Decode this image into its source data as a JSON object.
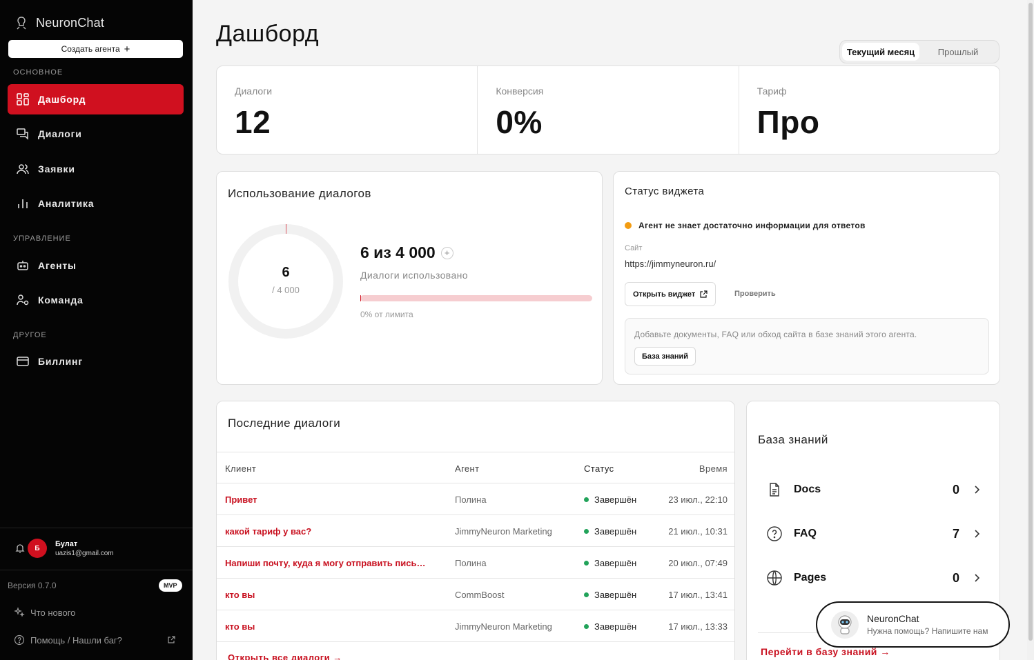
{
  "brand": {
    "name": "NeuronChat"
  },
  "sidebar": {
    "create_label": "Создать агента",
    "sections": {
      "main": "ОСНОВНОЕ",
      "manage": "УПРАВЛЕНИЕ",
      "other": "ДРУГОЕ"
    },
    "items": {
      "dashboard": "Дашборд",
      "dialogs": "Диалоги",
      "requests": "Заявки",
      "analytics": "Аналитика",
      "agents": "Агенты",
      "team": "Команда",
      "billing": "Биллинг"
    },
    "user": {
      "initial": "Б",
      "name": "Булат",
      "email": "uazis1@gmail.com"
    },
    "version": "Версия 0.7.0",
    "badge": "MVP",
    "whats_new": "Что нового",
    "help": "Помощь / Нашли баг?"
  },
  "page": {
    "title": "Дашборд"
  },
  "period": {
    "current": "Текущий месяц",
    "previous": "Прошлый"
  },
  "stats": [
    {
      "label": "Диалоги",
      "value": "12"
    },
    {
      "label": "Конверсия",
      "value": "0%"
    },
    {
      "label": "Тариф",
      "value": "Про"
    }
  ],
  "usage": {
    "title": "Использование диалогов",
    "ring_value": "6",
    "ring_total": "/ 4 000",
    "big": "6 из 4 000",
    "sub": "Диалоги использовано",
    "fraction": 0.0015,
    "pct_label": "0% от лимита"
  },
  "widget": {
    "title": "Статус виджета",
    "status": "Агент не знает достаточно информации для ответов",
    "status_color": "#f39c12",
    "site_label": "Сайт",
    "site_url": "https://jimmyneuron.ru/",
    "open_label": "Открыть виджет",
    "check_label": "Проверить",
    "hint": "Добавьте документы, FAQ или обход сайта в базе знаний этого агента.",
    "kb_button": "База знаний"
  },
  "recent": {
    "title": "Последние диалоги",
    "columns": {
      "client": "Клиент",
      "agent": "Агент",
      "status": "Статус",
      "time": "Время"
    },
    "rows": [
      {
        "client": "Привет",
        "agent": "Полина",
        "status": "Завершён",
        "time": "23 июл., 22:10"
      },
      {
        "client": "какой тариф у вас?",
        "agent": "JimmyNeuron Marketing",
        "status": "Завершён",
        "time": "21 июл., 10:31"
      },
      {
        "client": "Напиши почту, куда я могу отправить пись…",
        "agent": "Полина",
        "status": "Завершён",
        "time": "20 июл., 07:49"
      },
      {
        "client": "кто вы",
        "agent": "CommBoost",
        "status": "Завершён",
        "time": "17 июл., 13:41"
      },
      {
        "client": "кто вы",
        "agent": "JimmyNeuron Marketing",
        "status": "Завершён",
        "time": "17 июл., 13:33"
      }
    ],
    "all_link": "Открыть все диалоги →"
  },
  "kb": {
    "title": "База знаний",
    "items": [
      {
        "name": "Docs",
        "count": "0",
        "icon": "document-icon"
      },
      {
        "name": "FAQ",
        "count": "7",
        "icon": "question-icon"
      },
      {
        "name": "Pages",
        "count": "0",
        "icon": "globe-icon"
      }
    ],
    "link": "Перейти в базу знаний →"
  },
  "chat": {
    "name": "NeuronChat",
    "sub": "Нужна помощь? Напишите нам"
  },
  "colors": {
    "accent": "#d0101f",
    "link": "#c8101f",
    "success": "#22a35a"
  }
}
